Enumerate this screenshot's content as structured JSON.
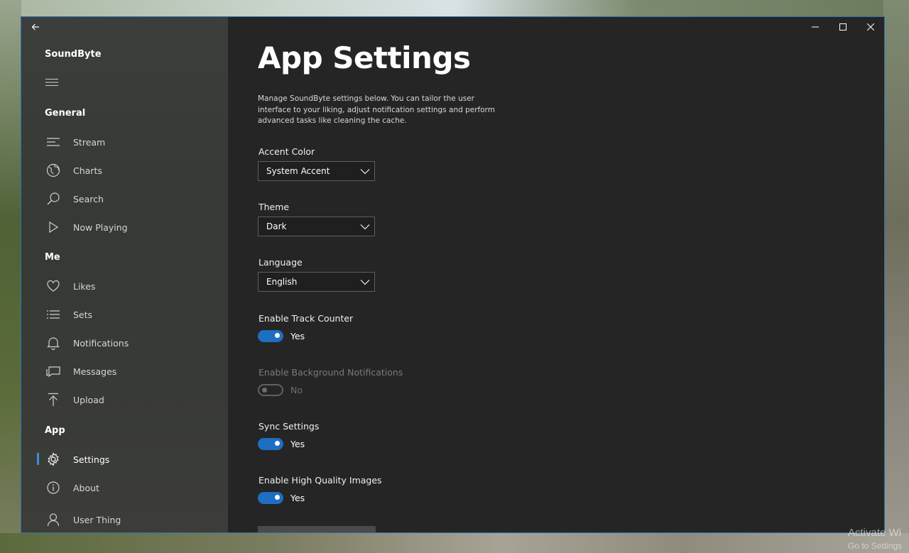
{
  "app": {
    "name": "SoundByte"
  },
  "sidebar": {
    "sections": {
      "general": "General",
      "me": "Me",
      "app": "App"
    },
    "items": {
      "stream": {
        "label": "Stream",
        "icon": "stream-icon"
      },
      "charts": {
        "label": "Charts",
        "icon": "globe-icon"
      },
      "search": {
        "label": "Search",
        "icon": "search-icon"
      },
      "now_playing": {
        "label": "Now Playing",
        "icon": "play-icon"
      },
      "likes": {
        "label": "Likes",
        "icon": "heart-icon"
      },
      "sets": {
        "label": "Sets",
        "icon": "list-icon"
      },
      "notifications": {
        "label": "Notifications",
        "icon": "bell-icon"
      },
      "messages": {
        "label": "Messages",
        "icon": "message-icon"
      },
      "upload": {
        "label": "Upload",
        "icon": "upload-icon"
      },
      "settings": {
        "label": "Settings",
        "icon": "gear-icon",
        "active": true
      },
      "about": {
        "label": "About",
        "icon": "info-icon"
      },
      "user": {
        "label": "User Thing",
        "icon": "user-icon"
      }
    }
  },
  "main": {
    "title": "App Settings",
    "description": "Manage SoundByte settings below. You can tailor the user interface to your liking, adjust notification settings and perform advanced tasks like cleaning the cache.",
    "accent_color": {
      "label": "Accent Color",
      "value": "System Accent"
    },
    "theme": {
      "label": "Theme",
      "value": "Dark"
    },
    "language": {
      "label": "Language",
      "value": "English"
    },
    "track_counter": {
      "label": "Enable Track Counter",
      "state": "Yes",
      "on": true
    },
    "background_notifications": {
      "label": "Enable Background Notifications",
      "state": "No",
      "on": false,
      "disabled": true
    },
    "sync_settings": {
      "label": "Sync Settings",
      "state": "Yes",
      "on": true
    },
    "high_quality_images": {
      "label": "Enable High Quality Images",
      "state": "Yes",
      "on": true
    }
  },
  "desktop": {
    "watermark_line1": "Activate Wi",
    "watermark_line2": "Go to Settings"
  },
  "colors": {
    "accent": "#1e6ec2",
    "window_border": "#2f6fb0",
    "content_bg": "#252525"
  }
}
